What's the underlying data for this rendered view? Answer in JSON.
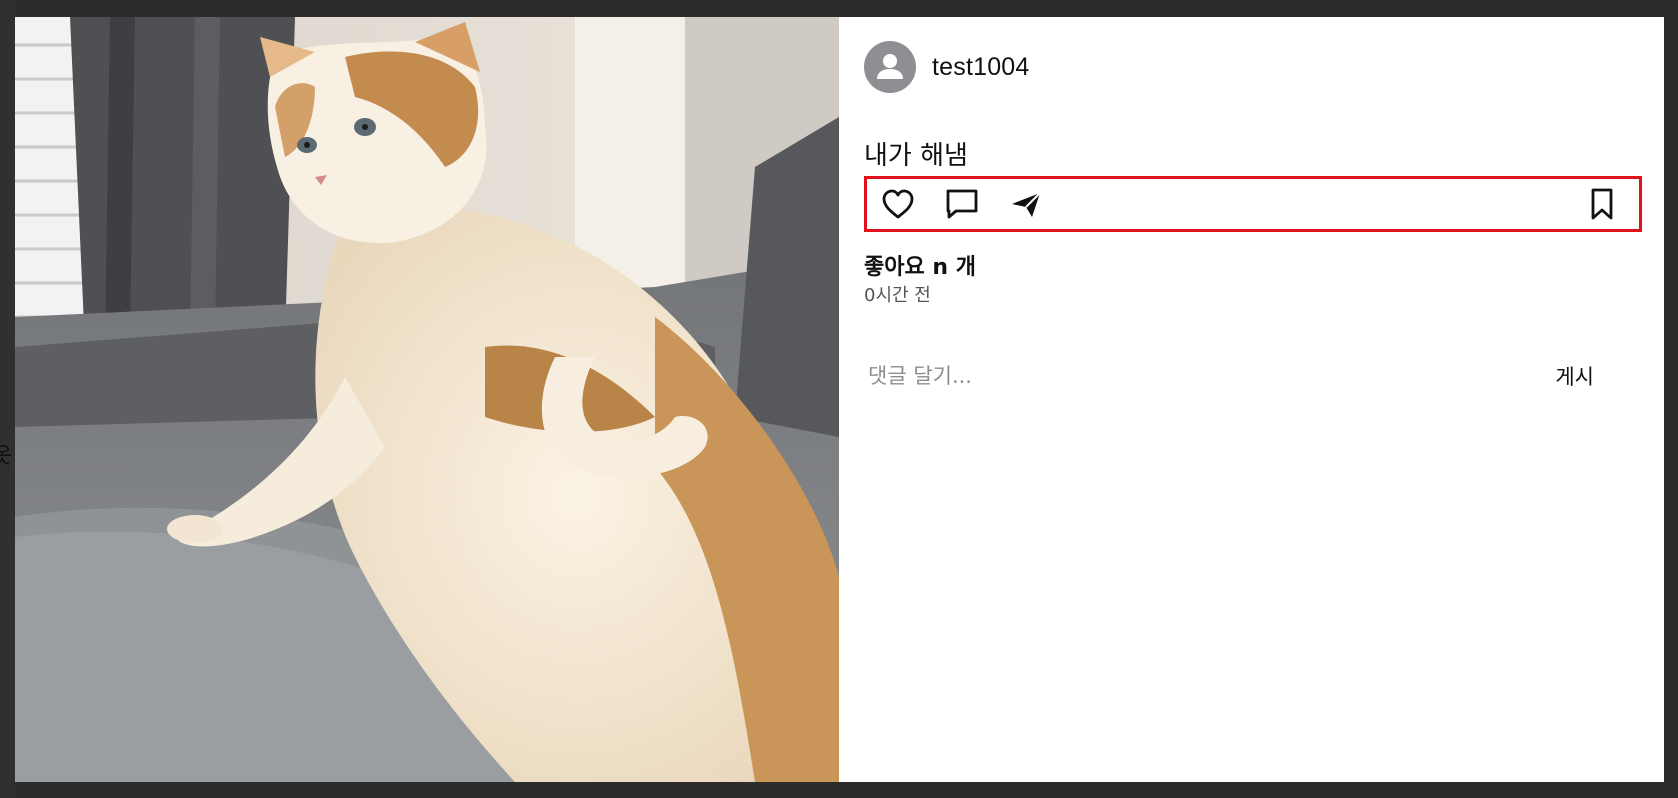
{
  "backdrop": {
    "glyph": "옷"
  },
  "post": {
    "photo_icon": "cat-photo",
    "author": {
      "username": "test1004",
      "avatar_icon": "default-user-icon"
    },
    "caption": "내가 해냄",
    "actions": {
      "like_icon": "heart-icon",
      "comment_icon": "comment-icon",
      "share_icon": "paper-plane-icon",
      "save_icon": "bookmark-icon",
      "highlight_color": "#e0111b"
    },
    "likes_label": "좋아요 n 개",
    "time_label": "0시간 전",
    "comment": {
      "placeholder": "댓글 달기...",
      "value": "",
      "post_label": "게시"
    }
  }
}
